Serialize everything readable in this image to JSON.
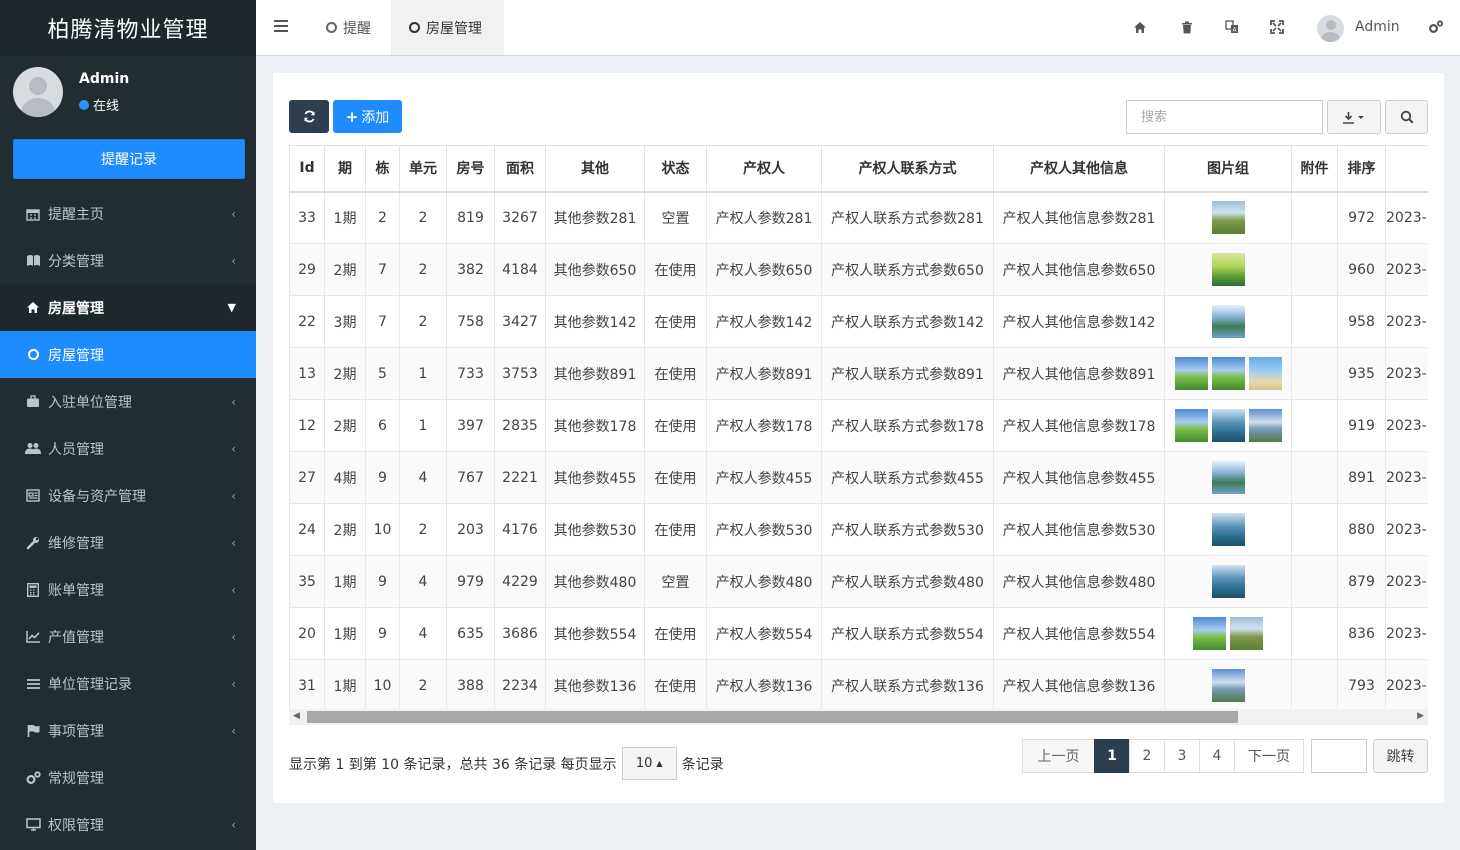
{
  "app": {
    "title": "柏腾清物业管理"
  },
  "user": {
    "name": "Admin",
    "status": "在线"
  },
  "sidebar": {
    "remind_button": "提醒记录",
    "items": [
      {
        "label": "提醒主页",
        "icon": "calendar-icon"
      },
      {
        "label": "分类管理",
        "icon": "book-icon"
      },
      {
        "label": "房屋管理",
        "icon": "home-icon"
      },
      {
        "label": "房屋管理",
        "icon": "circle-icon"
      },
      {
        "label": "入驻单位管理",
        "icon": "briefcase-icon"
      },
      {
        "label": "人员管理",
        "icon": "users-icon"
      },
      {
        "label": "设备与资产管理",
        "icon": "newspaper-icon"
      },
      {
        "label": "维修管理",
        "icon": "wrench-icon"
      },
      {
        "label": "账单管理",
        "icon": "calculator-icon"
      },
      {
        "label": "产值管理",
        "icon": "line-chart-icon"
      },
      {
        "label": "单位管理记录",
        "icon": "list-icon"
      },
      {
        "label": "事项管理",
        "icon": "flag-icon"
      },
      {
        "label": "常规管理",
        "icon": "cogs-icon"
      },
      {
        "label": "权限管理",
        "icon": "desktop-icon"
      }
    ]
  },
  "header": {
    "tabs": [
      {
        "label": "提醒"
      },
      {
        "label": "房屋管理"
      }
    ],
    "user": "Admin"
  },
  "toolbar": {
    "add_label": "添加",
    "search_placeholder": "搜索"
  },
  "table": {
    "headers": [
      "Id",
      "期",
      "栋",
      "单元",
      "房号",
      "面积",
      "其他",
      "状态",
      "产权人",
      "产权人联系方式",
      "产权人其他信息",
      "图片组",
      "附件",
      "排序",
      ""
    ],
    "rows": [
      {
        "id": "33",
        "qi": "1期",
        "dong": "2",
        "unit": "2",
        "room": "819",
        "area": "3267",
        "other": "其他参数281",
        "status": "空置",
        "owner": "产权人参数281",
        "contact": "产权人联系方式参数281",
        "info": "产权人其他信息参数281",
        "sort": "972",
        "date": "2023-",
        "imgs": [
          "t-field"
        ]
      },
      {
        "id": "29",
        "qi": "2期",
        "dong": "7",
        "unit": "2",
        "room": "382",
        "area": "4184",
        "other": "其他参数650",
        "status": "在使用",
        "owner": "产权人参数650",
        "contact": "产权人联系方式参数650",
        "info": "产权人其他信息参数650",
        "sort": "960",
        "date": "2023-",
        "imgs": [
          "t-road"
        ]
      },
      {
        "id": "22",
        "qi": "3期",
        "dong": "7",
        "unit": "2",
        "room": "758",
        "area": "3427",
        "other": "其他参数142",
        "status": "在使用",
        "owner": "产权人参数142",
        "contact": "产权人联系方式参数142",
        "info": "产权人其他信息参数142",
        "sort": "958",
        "date": "2023-",
        "imgs": [
          "t-river"
        ]
      },
      {
        "id": "13",
        "qi": "2期",
        "dong": "5",
        "unit": "1",
        "room": "733",
        "area": "3753",
        "other": "其他参数891",
        "status": "在使用",
        "owner": "产权人参数891",
        "contact": "产权人联系方式参数891",
        "info": "产权人其他信息参数891",
        "sort": "935",
        "date": "2023-",
        "imgs": [
          "t-meadow",
          "t-meadow",
          "t-beach"
        ]
      },
      {
        "id": "12",
        "qi": "2期",
        "dong": "6",
        "unit": "1",
        "room": "397",
        "area": "2835",
        "other": "其他参数178",
        "status": "在使用",
        "owner": "产权人参数178",
        "contact": "产权人联系方式参数178",
        "info": "产权人其他信息参数178",
        "sort": "919",
        "date": "2023-",
        "imgs": [
          "t-meadow",
          "t-lake",
          "t-mount"
        ]
      },
      {
        "id": "27",
        "qi": "4期",
        "dong": "9",
        "unit": "4",
        "room": "767",
        "area": "2221",
        "other": "其他参数455",
        "status": "在使用",
        "owner": "产权人参数455",
        "contact": "产权人联系方式参数455",
        "info": "产权人其他信息参数455",
        "sort": "891",
        "date": "2023-",
        "imgs": [
          "t-river"
        ]
      },
      {
        "id": "24",
        "qi": "2期",
        "dong": "10",
        "unit": "2",
        "room": "203",
        "area": "4176",
        "other": "其他参数530",
        "status": "在使用",
        "owner": "产权人参数530",
        "contact": "产权人联系方式参数530",
        "info": "产权人其他信息参数530",
        "sort": "880",
        "date": "2023-",
        "imgs": [
          "t-lake"
        ]
      },
      {
        "id": "35",
        "qi": "1期",
        "dong": "9",
        "unit": "4",
        "room": "979",
        "area": "4229",
        "other": "其他参数480",
        "status": "空置",
        "owner": "产权人参数480",
        "contact": "产权人联系方式参数480",
        "info": "产权人其他信息参数480",
        "sort": "879",
        "date": "2023-",
        "imgs": [
          "t-lake"
        ]
      },
      {
        "id": "20",
        "qi": "1期",
        "dong": "9",
        "unit": "4",
        "room": "635",
        "area": "3686",
        "other": "其他参数554",
        "status": "在使用",
        "owner": "产权人参数554",
        "contact": "产权人联系方式参数554",
        "info": "产权人其他信息参数554",
        "sort": "836",
        "date": "2023-",
        "imgs": [
          "t-meadow",
          "t-field"
        ]
      },
      {
        "id": "31",
        "qi": "1期",
        "dong": "10",
        "unit": "2",
        "room": "388",
        "area": "2234",
        "other": "其他参数136",
        "status": "在使用",
        "owner": "产权人参数136",
        "contact": "产权人联系方式参数136",
        "info": "产权人其他信息参数136",
        "sort": "793",
        "date": "2023-",
        "imgs": [
          "t-mount"
        ]
      }
    ]
  },
  "footer": {
    "info_text": "显示第 1 到第 10 条记录，总共 36 条记录 每页显示",
    "page_size": "10",
    "suffix": "条记录",
    "prev": "上一页",
    "pages": [
      "1",
      "2",
      "3",
      "4"
    ],
    "next": "下一页",
    "jump": "跳转"
  },
  "colors": {
    "sidebar_bg": "#222d32",
    "accent": "#1e8cff",
    "dark_button": "#2c3e50"
  }
}
